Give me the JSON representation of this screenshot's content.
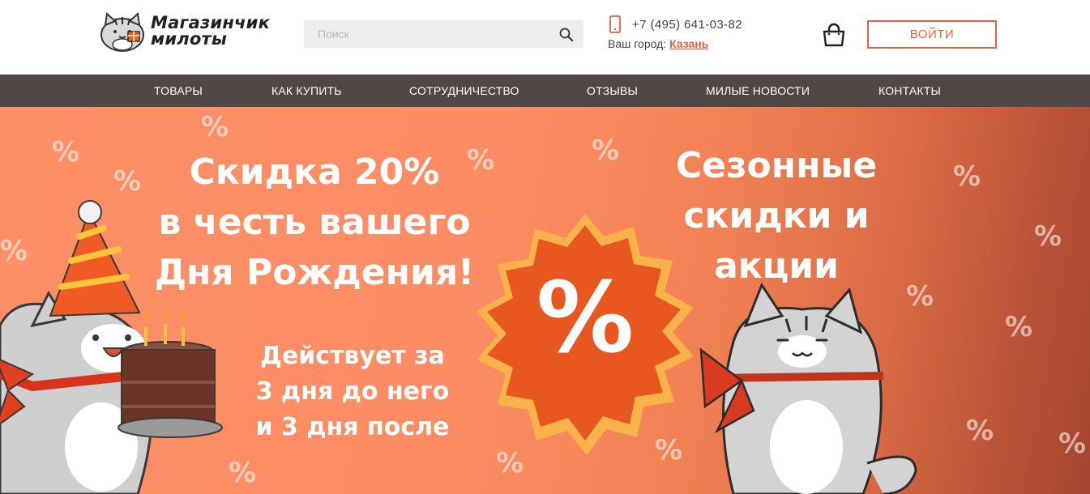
{
  "header": {
    "logo_line1": "Магазинчик",
    "logo_line2": "милоты",
    "search_placeholder": "Поиск",
    "phone": "+7 (495) 641-03-82",
    "city_label": "Ваш город:",
    "city_value": "Казань",
    "login_label": "ВОЙТИ"
  },
  "nav": {
    "items": [
      {
        "label": "ТОВАРЫ"
      },
      {
        "label": "КАК КУПИТЬ"
      },
      {
        "label": "СОТРУДНИЧЕСТВО"
      },
      {
        "label": "ОТЗЫВЫ"
      },
      {
        "label": "МИЛЫЕ НОВОСТИ"
      },
      {
        "label": "КОНТАКТЫ"
      }
    ]
  },
  "banner": {
    "headline_left": [
      "Скидка 20%",
      "в честь вашего",
      "Дня Рождения!"
    ],
    "subtext_left": [
      "Действует за",
      "3 дня до него",
      "и 3 дня после"
    ],
    "headline_right": [
      "Сезонные",
      "скидки и",
      "акции"
    ],
    "badge_symbol": "%",
    "deco_symbol": "%"
  },
  "colors": {
    "accent": "#e8603c",
    "nav_bg": "#514746",
    "banner_left": "#fd8f66",
    "banner_right": "#a4442d",
    "badge": "#e8571f"
  },
  "icons": {
    "search": "search-icon",
    "phone": "phone-icon",
    "cart": "shopping-bag-icon"
  }
}
